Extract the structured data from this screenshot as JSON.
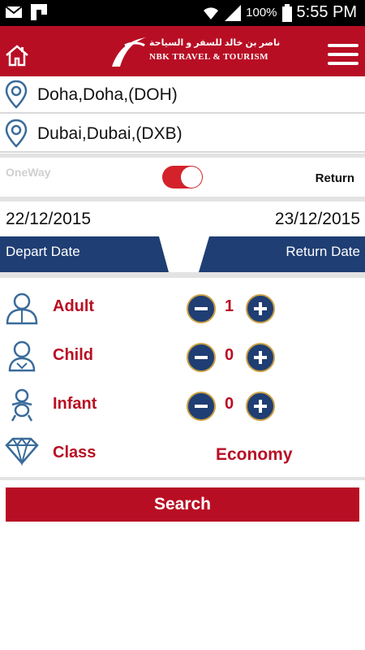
{
  "status_bar": {
    "battery": "100%",
    "time": "5:55 PM"
  },
  "header": {
    "logo_arabic": "ناصر بن خالد للسفر و السياحة",
    "logo_english": "NBK TRAVEL & TOURISM"
  },
  "route": {
    "from": "Doha,Doha,(DOH)",
    "to": "Dubai,Dubai,(DXB)"
  },
  "trip_type": {
    "oneway_label": "OneWay",
    "return_label": "Return",
    "selected": "Return"
  },
  "dates": {
    "depart_value": "22/12/2015",
    "return_value": "23/12/2015",
    "depart_label": "Depart Date",
    "return_label": "Return Date"
  },
  "passengers": {
    "adult": {
      "label": "Adult",
      "count": "1"
    },
    "child": {
      "label": "Child",
      "count": "0"
    },
    "infant": {
      "label": "Infant",
      "count": "0"
    }
  },
  "travel_class": {
    "label": "Class",
    "value": "Economy"
  },
  "search_label": "Search",
  "colors": {
    "brand_red": "#b80e24",
    "navy": "#1f3e73",
    "gold_border": "#c9a043",
    "toggle_red": "#d3222a"
  }
}
